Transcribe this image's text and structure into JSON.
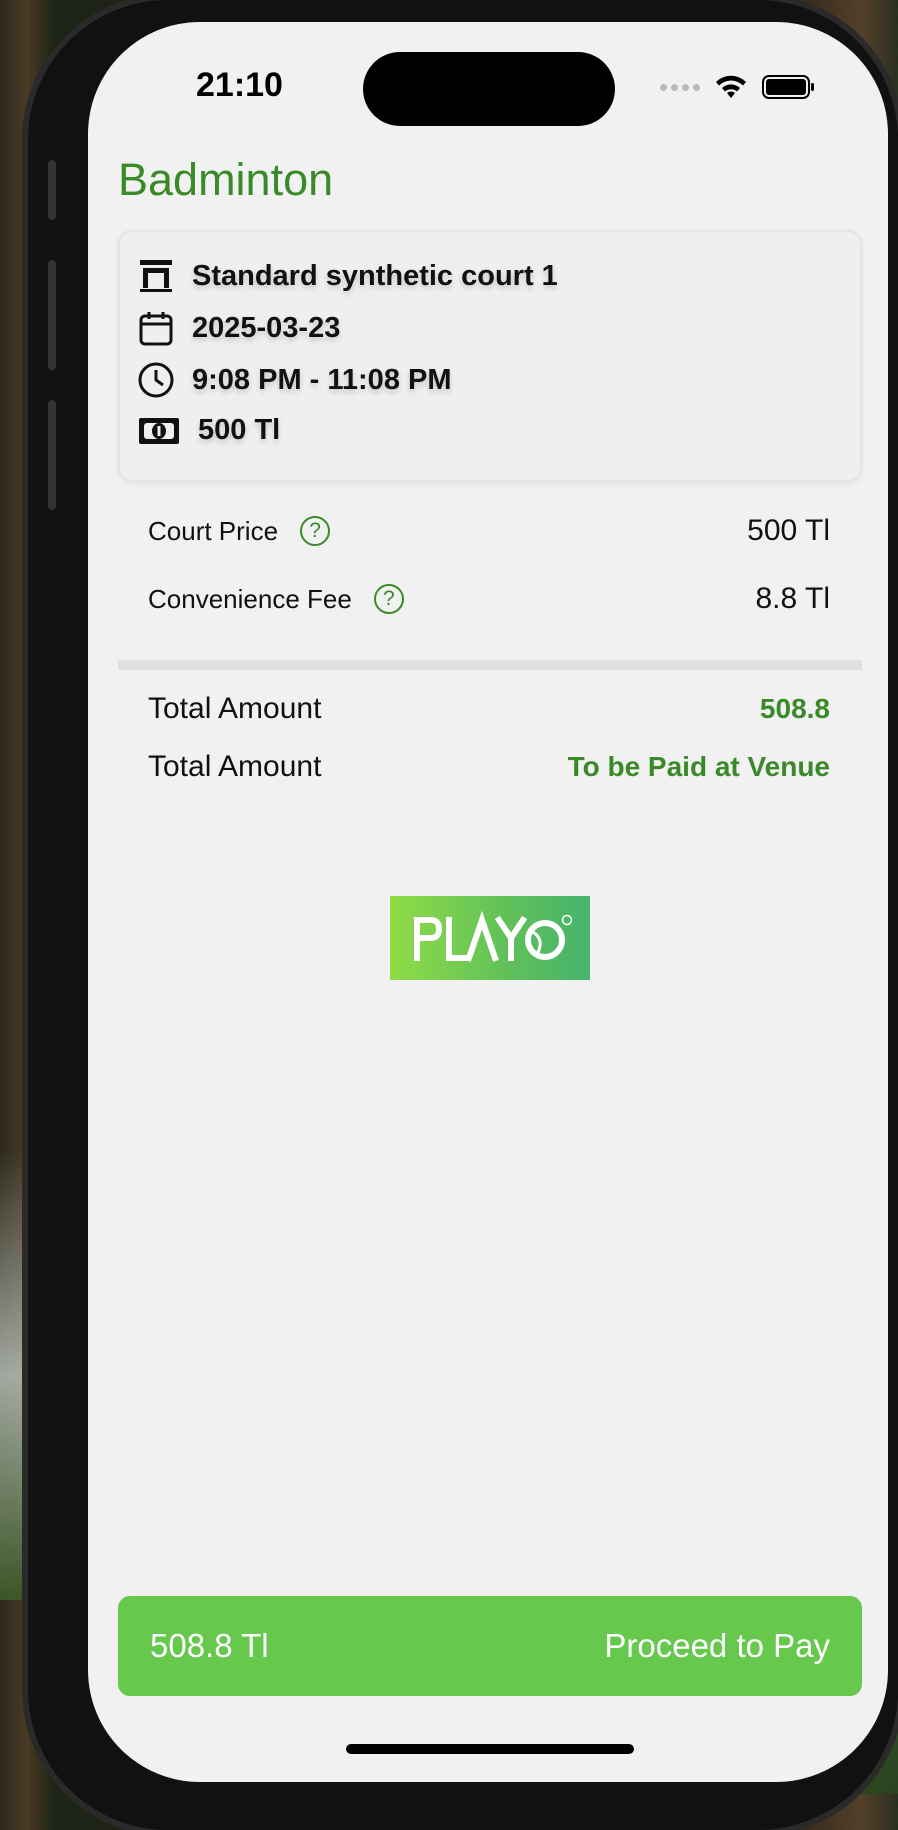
{
  "status_bar": {
    "time": "21:10"
  },
  "page": {
    "title": "Badminton"
  },
  "booking": {
    "court": "Standard synthetic court 1",
    "date": "2025-03-23",
    "time_range": "9:08 PM - 11:08 PM",
    "price": "500 Tl"
  },
  "charges": [
    {
      "label": "Court Price",
      "value": "500 Tl"
    },
    {
      "label": "Convenience Fee",
      "value": "8.8 Tl"
    }
  ],
  "totals": [
    {
      "label": "Total Amount",
      "value": "508.8"
    },
    {
      "label": "Total Amount",
      "value": "To be Paid at Venue"
    }
  ],
  "help_glyph": "?",
  "logo": {
    "text": "PLAYO"
  },
  "pay_button": {
    "amount": "508.8 Tl",
    "label": "Proceed to Pay"
  },
  "colors": {
    "accent": "#3a8a2a",
    "button": "#66c84c",
    "background": "#f1f1f1"
  },
  "icons": [
    "court-icon",
    "calendar-icon",
    "clock-icon",
    "cash-icon",
    "help-icon",
    "wifi-icon",
    "battery-icon"
  ]
}
